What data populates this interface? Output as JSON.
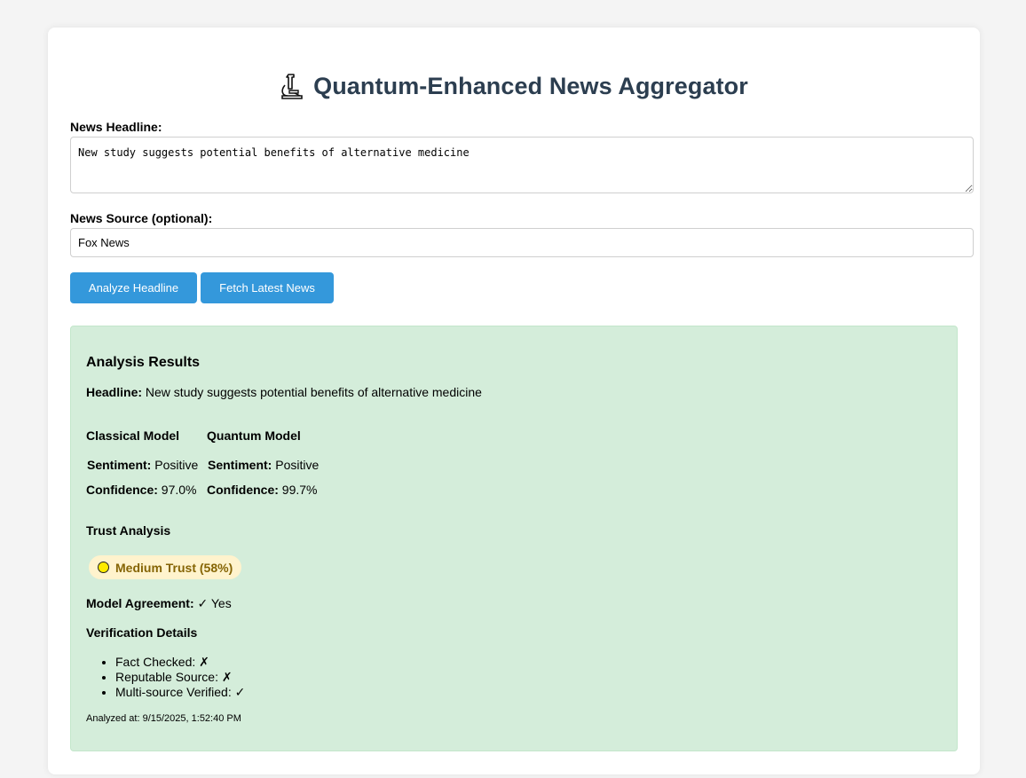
{
  "header": {
    "title": "Quantum-Enhanced News Aggregator",
    "icon": "microscope-icon"
  },
  "form": {
    "headline_label": "News Headline:",
    "headline_value": "New study suggests potential benefits of alternative medicine",
    "source_label": "News Source (optional):",
    "source_value": "Fox News"
  },
  "buttons": {
    "analyze": "Analyze Headline",
    "fetch": "Fetch Latest News"
  },
  "results": {
    "title": "Analysis Results",
    "headline_label": "Headline:",
    "headline_value": "New study suggests potential benefits of alternative medicine",
    "classical": {
      "title": "Classical Model",
      "sentiment_label": "Sentiment:",
      "sentiment_value": "Positive",
      "confidence_label": "Confidence:",
      "confidence_value": "97.0%"
    },
    "quantum": {
      "title": "Quantum Model",
      "sentiment_label": "Sentiment:",
      "sentiment_value": "Positive",
      "confidence_label": "Confidence:",
      "confidence_value": "99.7%"
    },
    "trust_title": "Trust Analysis",
    "trust_badge": "Medium Trust (58%)",
    "agreement_label": "Model Agreement:",
    "agreement_value": "✓ Yes",
    "verification_title": "Verification Details",
    "verification": [
      "Fact Checked: ✗",
      "Reputable Source: ✗",
      "Multi-source Verified: ✓"
    ],
    "timestamp": "Analyzed at: 9/15/2025, 1:52:40 PM"
  },
  "colors": {
    "accent": "#3498db",
    "title": "#2c3e50",
    "results_bg": "#d4edda",
    "trust_bg": "#fff3cd",
    "trust_text": "#856404"
  }
}
